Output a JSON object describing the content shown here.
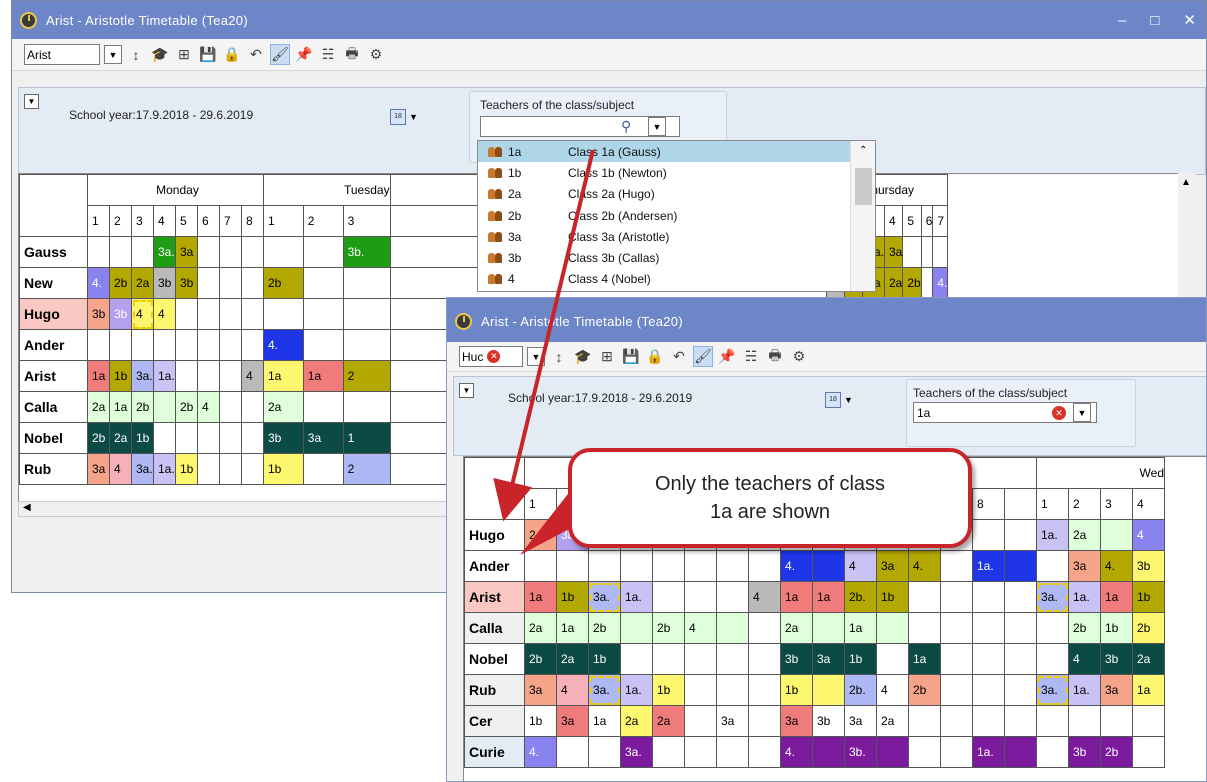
{
  "colors": {
    "titlebar": "#6d86c7",
    "panel": "#e3ebf5",
    "callout_border": "#c8242a"
  },
  "back": {
    "title": "Arist - Aristotle  Timetable  (Tea20)",
    "teacher_select": "Arist",
    "school_year": "School year:17.9.2018 - 29.6.2019",
    "filter_label": "Teachers of the class/subject",
    "filter_value": "",
    "days": [
      "Monday",
      "Tuesday",
      "Thursday"
    ],
    "hours": [
      "1",
      "2",
      "3",
      "4",
      "5",
      "6",
      "7",
      "8"
    ],
    "rows": [
      {
        "name": "Gauss",
        "mon": [
          "",
          "",
          "",
          "3a.",
          "3a",
          "",
          "",
          ""
        ]
      },
      {
        "name": "New",
        "mon": [
          "4.",
          "2b",
          "2a",
          "3b",
          "3b",
          "",
          "",
          ""
        ]
      },
      {
        "name": "Hugo",
        "mon": [
          "3b",
          "3b",
          "4",
          "4",
          "",
          "",
          "",
          ""
        ]
      },
      {
        "name": "Ander",
        "mon": [
          "",
          "",
          "",
          "",
          "",
          "",
          "",
          ""
        ]
      },
      {
        "name": "Arist",
        "mon": [
          "1a",
          "1b",
          "3a.",
          "1a.",
          "",
          "",
          "",
          "4"
        ]
      },
      {
        "name": "Calla",
        "mon": [
          "2a",
          "1a",
          "2b",
          "",
          "2b",
          "4",
          "",
          ""
        ]
      },
      {
        "name": "Nobel",
        "mon": [
          "2b",
          "2a",
          "1b",
          "",
          "",
          "",
          "",
          ""
        ]
      },
      {
        "name": "Rub",
        "mon": [
          "3a",
          "4",
          "3a.",
          "1a.",
          "1b",
          "",
          "",
          ""
        ]
      }
    ],
    "tue_peek": [
      [
        "",
        "",
        "3b."
      ],
      [
        "2b",
        "",
        ""
      ],
      [
        "",
        "",
        ""
      ],
      [
        "4.",
        "",
        ""
      ],
      [
        "1a",
        "1a",
        "2"
      ],
      [
        "2a",
        "",
        ""
      ],
      [
        "3b",
        "3a",
        "1"
      ],
      [
        "1b",
        "",
        "2"
      ]
    ],
    "thu_gauss": [
      "",
      "",
      "3a.",
      "3a",
      "",
      "",
      ""
    ],
    "thu_new": [
      "3a",
      "3b",
      "2a",
      "2a",
      "2b",
      "",
      "4."
    ],
    "dropdown": [
      {
        "short": "1a",
        "long": "Class 1a (Gauss)"
      },
      {
        "short": "1b",
        "long": "Class 1b (Newton)"
      },
      {
        "short": "2a",
        "long": "Class 2a (Hugo)"
      },
      {
        "short": "2b",
        "long": "Class 2b (Andersen)"
      },
      {
        "short": "3a",
        "long": "Class 3a (Aristotle)"
      },
      {
        "short": "3b",
        "long": "Class 3b (Callas)"
      },
      {
        "short": "4",
        "long": "Class 4 (Nobel)"
      }
    ]
  },
  "front": {
    "title": "Arist - Aristotle  Timetable  (Tea20)",
    "teacher_select": "Huc",
    "school_year": "School year:17.9.2018 - 29.6.2019",
    "filter_label": "Teachers of the class/subject",
    "filter_value": "1a",
    "day_wed": "Wed",
    "rows": [
      {
        "name": "Hugo"
      },
      {
        "name": "Ander"
      },
      {
        "name": "Arist"
      },
      {
        "name": "Calla"
      },
      {
        "name": "Nobel"
      },
      {
        "name": "Rub"
      },
      {
        "name": "Cer"
      },
      {
        "name": "Curie"
      }
    ]
  },
  "callout": {
    "line1": "Only the teachers of class",
    "line2": "1a are shown"
  }
}
